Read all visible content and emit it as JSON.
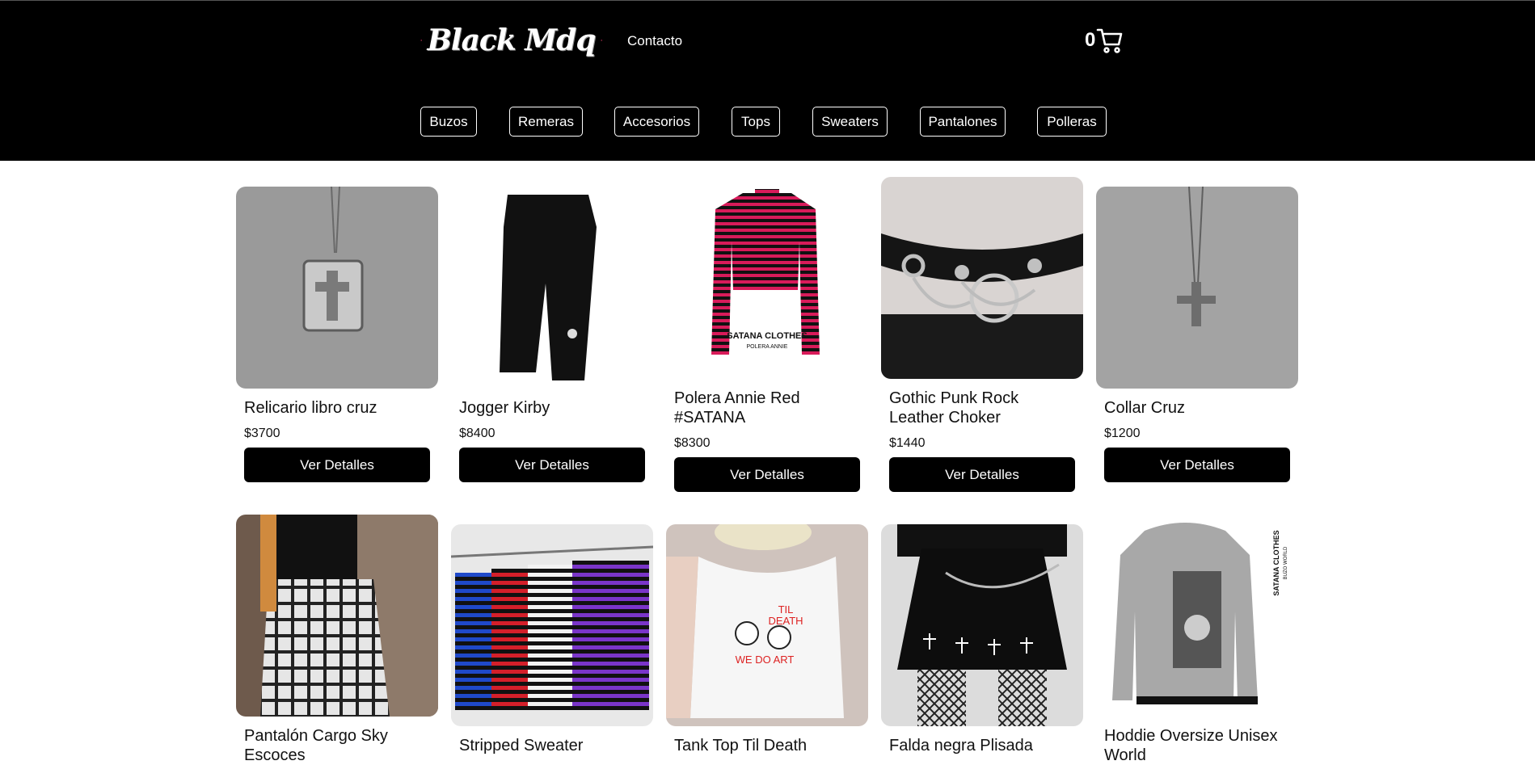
{
  "header": {
    "brand": "Black Mdq",
    "contact_label": "Contacto",
    "cart_count": "0"
  },
  "categories": [
    "Buzos",
    "Remeras",
    "Accesorios",
    "Tops",
    "Sweaters",
    "Pantalones",
    "Polleras"
  ],
  "products": [
    {
      "title": "Relicario libro cruz",
      "price": "$3700",
      "button": "Ver Detalles"
    },
    {
      "title": "Jogger Kirby",
      "price": "$8400",
      "button": "Ver Detalles"
    },
    {
      "title": "Polera Annie Red #SATANA",
      "price": "$8300",
      "button": "Ver Detalles"
    },
    {
      "title": "Gothic Punk Rock Leather Choker",
      "price": "$1440",
      "button": "Ver Detalles"
    },
    {
      "title": "Collar Cruz",
      "price": "$1200",
      "button": "Ver Detalles"
    },
    {
      "title": "Pantalón Cargo Sky Escoces"
    },
    {
      "title": "Stripped Sweater"
    },
    {
      "title": "Tank Top Til Death"
    },
    {
      "title": "Falda negra Plisada"
    },
    {
      "title": "Hoddie Oversize Unisex World"
    }
  ],
  "image_text": {
    "polera_brand": "SATANA CLOTHES",
    "polera_sub": "POLERA ANNIE",
    "tank_line1": "TIL",
    "tank_line2": "DEATH",
    "tank_line3": "WE DO ART",
    "hoodie_brand": "SATANA CLOTHES",
    "hoodie_sub": "BUZO WORLD"
  },
  "colors": {
    "header_bg": "#000000",
    "button_bg": "#000000",
    "rose": "#b0144a",
    "stripe_pink": "#d81b5a"
  },
  "icons": {
    "cart": "cart-icon",
    "logo_rose": "rose-icon"
  }
}
